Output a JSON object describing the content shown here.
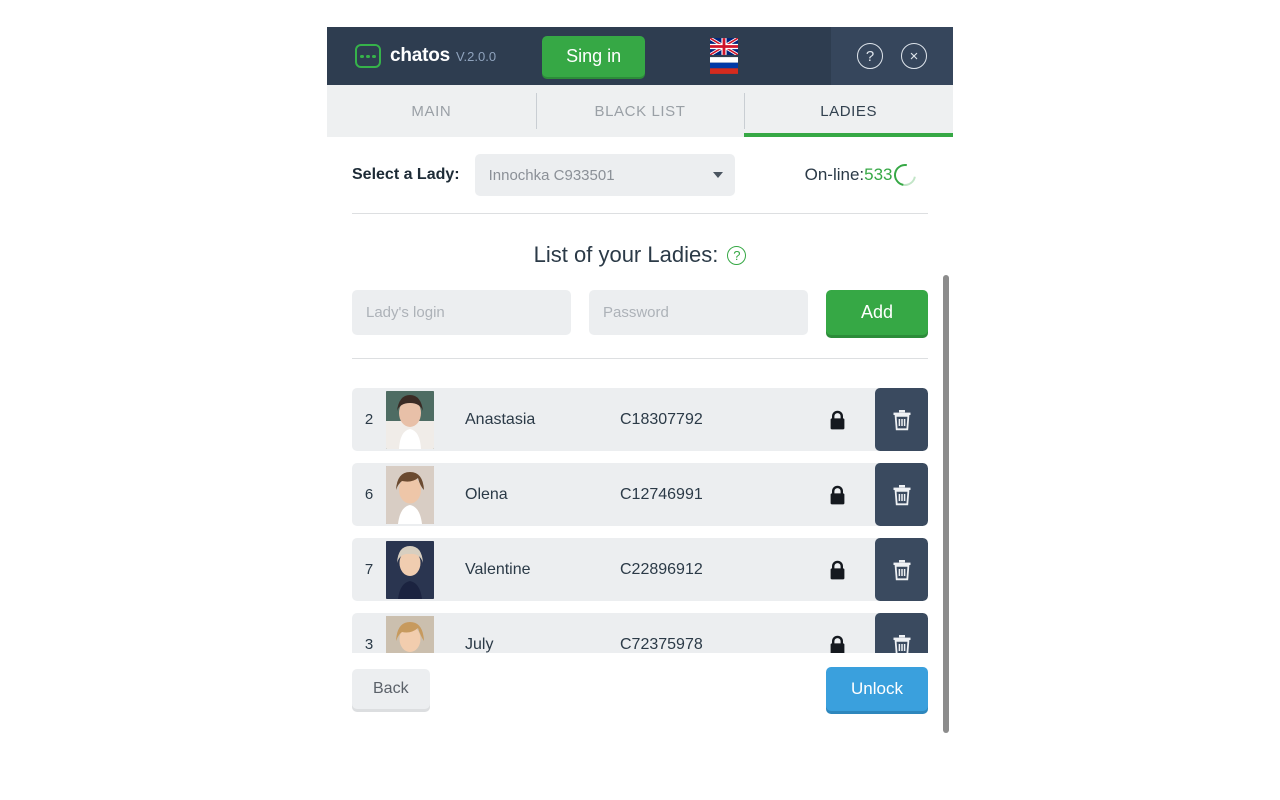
{
  "header": {
    "brand_name": "chatos",
    "version": "V.2.0.0",
    "signin_label": "Sing in",
    "help_icon_glyph": "?",
    "close_icon_glyph": "×",
    "languages": [
      "english-flag",
      "russian-flag"
    ]
  },
  "tabs": [
    {
      "label": "MAIN",
      "active": false
    },
    {
      "label": "BLACK LIST",
      "active": false
    },
    {
      "label": "LADIES",
      "active": true
    }
  ],
  "select_row": {
    "label": "Select a Lady:",
    "selected_value": "Innochka C933501",
    "online_label": "On-line:",
    "online_count": "533"
  },
  "list_section": {
    "title": "List of your Ladies:",
    "help_glyph": "?",
    "login_placeholder": "Lady's login",
    "login_value": "",
    "password_placeholder": "Password",
    "password_value": "",
    "add_label": "Add"
  },
  "ladies": [
    {
      "num": "2",
      "name": "Anastasia",
      "code": "C18307792",
      "locked": true
    },
    {
      "num": "6",
      "name": "Olena",
      "code": "C12746991",
      "locked": true
    },
    {
      "num": "7",
      "name": "Valentine",
      "code": "C22896912",
      "locked": true
    },
    {
      "num": "3",
      "name": "July",
      "code": "C72375978",
      "locked": true
    }
  ],
  "footer": {
    "back_label": "Back",
    "unlock_label": "Unlock",
    "note": ""
  },
  "colors": {
    "header_bg": "#2e3d50",
    "accent_green": "#36a845",
    "accent_blue": "#3aa0dd",
    "row_bg": "#eceef0",
    "delete_bg": "#3a4a5f"
  }
}
